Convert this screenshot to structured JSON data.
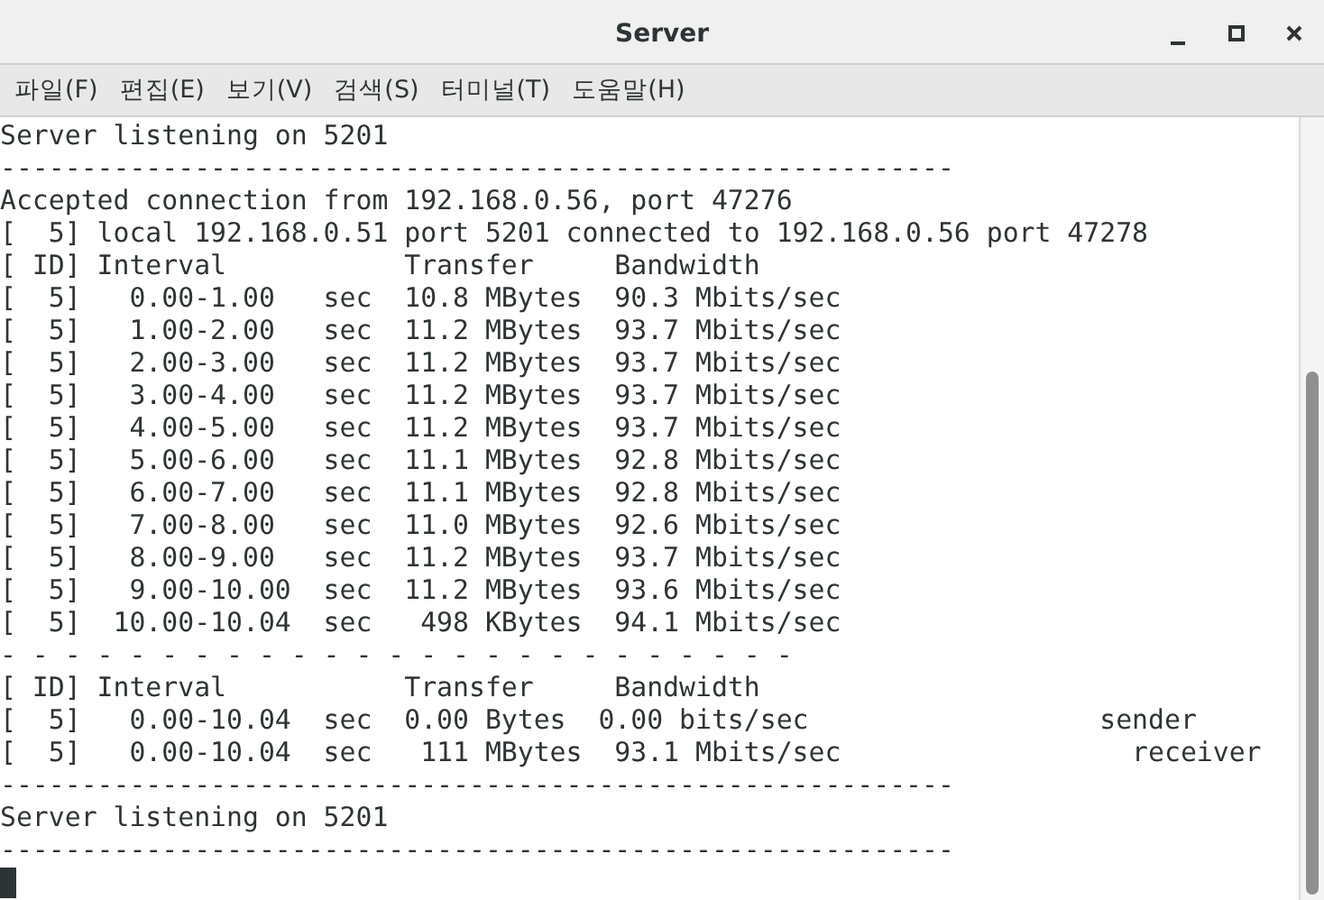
{
  "window": {
    "title": "Server"
  },
  "menu": [
    "파일(F)",
    "편집(E)",
    "보기(V)",
    "검색(S)",
    "터미널(T)",
    "도움말(H)"
  ],
  "terminal": {
    "lines": [
      "Server listening on 5201",
      "-----------------------------------------------------------",
      "Accepted connection from 192.168.0.56, port 47276",
      "[  5] local 192.168.0.51 port 5201 connected to 192.168.0.56 port 47278",
      "[ ID] Interval           Transfer     Bandwidth",
      "[  5]   0.00-1.00   sec  10.8 MBytes  90.3 Mbits/sec",
      "[  5]   1.00-2.00   sec  11.2 MBytes  93.7 Mbits/sec",
      "[  5]   2.00-3.00   sec  11.2 MBytes  93.7 Mbits/sec",
      "[  5]   3.00-4.00   sec  11.2 MBytes  93.7 Mbits/sec",
      "[  5]   4.00-5.00   sec  11.2 MBytes  93.7 Mbits/sec",
      "[  5]   5.00-6.00   sec  11.1 MBytes  92.8 Mbits/sec",
      "[  5]   6.00-7.00   sec  11.1 MBytes  92.8 Mbits/sec",
      "[  5]   7.00-8.00   sec  11.0 MBytes  92.6 Mbits/sec",
      "[  5]   8.00-9.00   sec  11.2 MBytes  93.7 Mbits/sec",
      "[  5]   9.00-10.00  sec  11.2 MBytes  93.6 Mbits/sec",
      "[  5]  10.00-10.04  sec   498 KBytes  94.1 Mbits/sec",
      "- - - - - - - - - - - - - - - - - - - - - - - - -",
      "[ ID] Interval           Transfer     Bandwidth",
      "[  5]   0.00-10.04  sec  0.00 Bytes  0.00 bits/sec                  sender",
      "[  5]   0.00-10.04  sec   111 MBytes  93.1 Mbits/sec                  receiver",
      "-----------------------------------------------------------",
      "Server listening on 5201",
      "-----------------------------------------------------------"
    ]
  }
}
